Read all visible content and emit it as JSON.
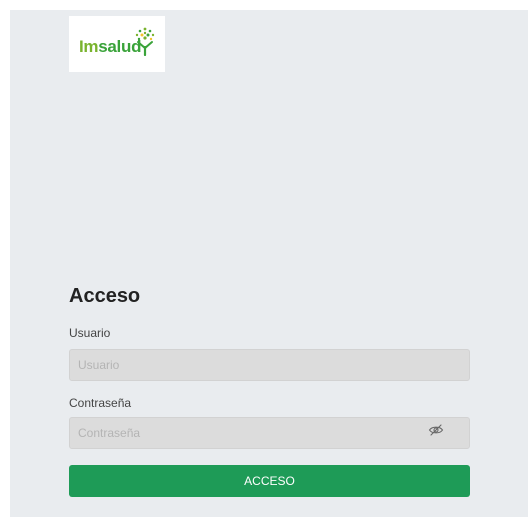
{
  "logo": {
    "text_im": "Im",
    "text_salud": "salud"
  },
  "login": {
    "title": "Acceso",
    "username_label": "Usuario",
    "username_placeholder": "Usuario",
    "username_value": "",
    "password_label": "Contraseña",
    "password_placeholder": "Contraseña",
    "password_value": "",
    "password_toggle_icon": "eye-slash-icon",
    "submit_label": "ACCESO"
  },
  "colors": {
    "background": "#e9ecef",
    "brand_green": "#3aa33a",
    "button": "#1e9b57",
    "input_bg": "#dcdcdc"
  }
}
